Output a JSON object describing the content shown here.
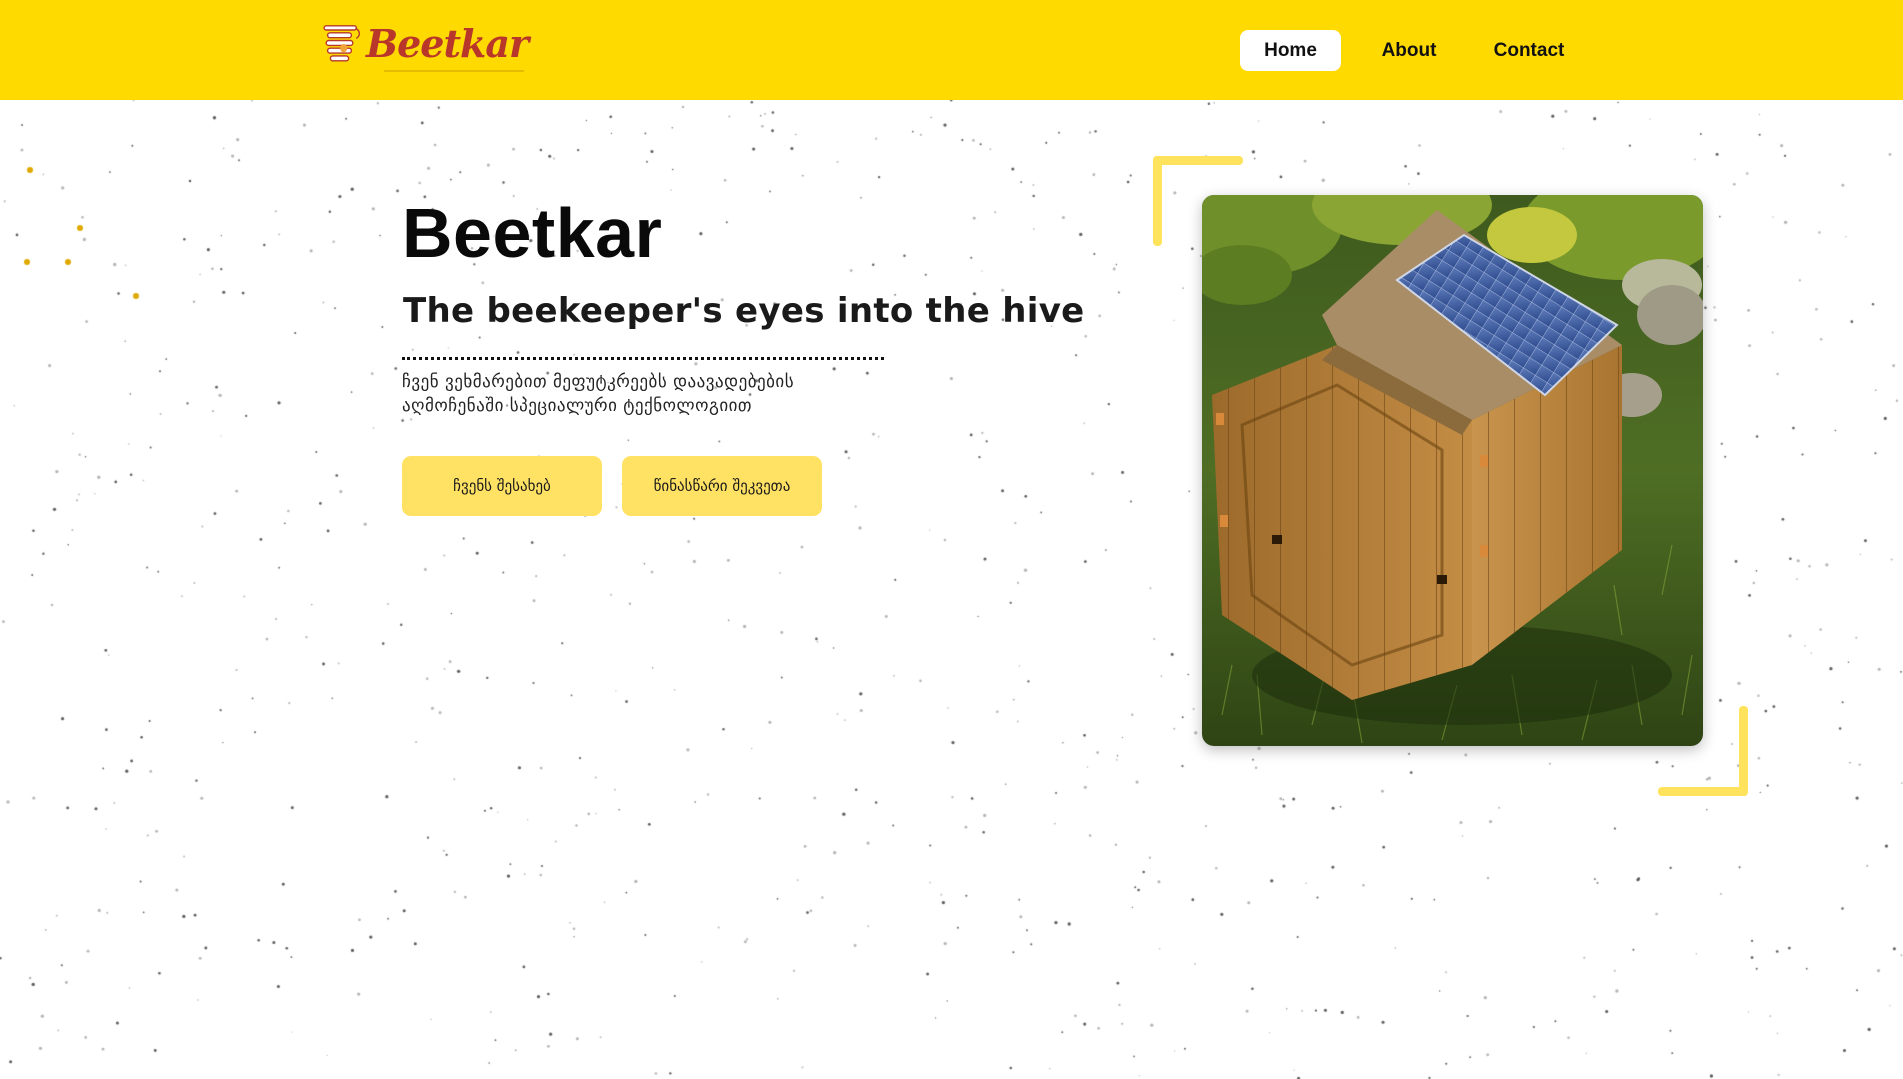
{
  "header": {
    "brand": "Beetkar",
    "nav": {
      "home": "Home",
      "about": "About",
      "contact": "Contact"
    }
  },
  "hero": {
    "title": "Beetkar",
    "subtitle": "The beekeeper's eyes into the hive",
    "description": "ჩვენ ვეხმარებით მეფუტკრეებს დაავადებების აღმოჩენაში სპეციალური ტექნოლოგიით",
    "buttons": {
      "about": "ჩვენს შესახებ",
      "preorder": "წინასწარი შეკვეთა"
    },
    "image": "hive-photo"
  },
  "colors": {
    "accent": "#ffda00",
    "button": "#ffe263",
    "brand_text": "#b8372a"
  }
}
